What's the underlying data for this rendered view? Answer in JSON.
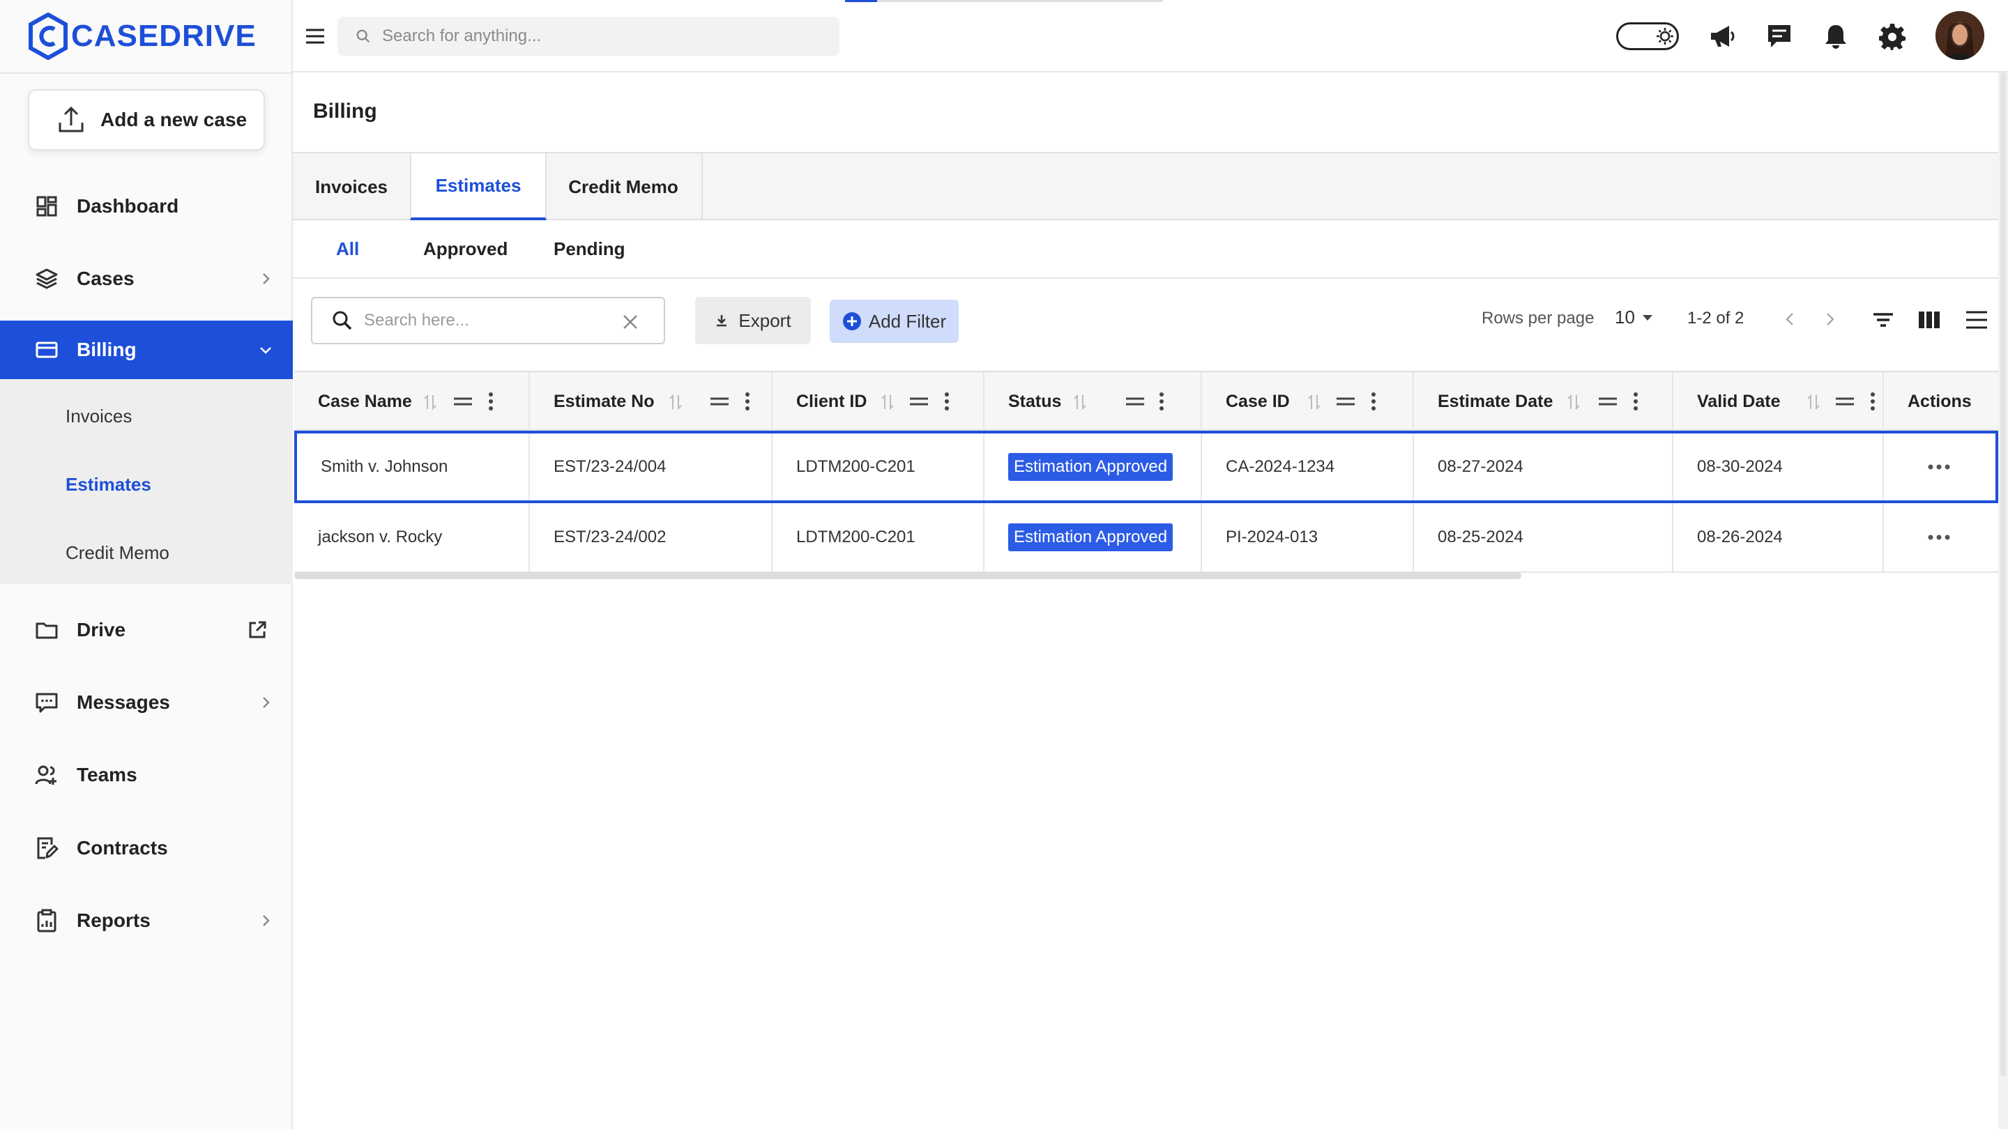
{
  "brand": {
    "name": "CASEDRIVE",
    "color": "#1d4fd8"
  },
  "sidebar": {
    "add_case_label": "Add a new case",
    "items": [
      {
        "label": "Dashboard",
        "icon": "dashboard-icon"
      },
      {
        "label": "Cases",
        "icon": "layers-icon"
      },
      {
        "label": "Billing",
        "icon": "credit-card-icon",
        "active": true
      },
      {
        "label": "Drive",
        "icon": "folder-icon"
      },
      {
        "label": "Messages",
        "icon": "message-icon"
      },
      {
        "label": "Teams",
        "icon": "team-icon"
      },
      {
        "label": "Contracts",
        "icon": "contract-icon"
      },
      {
        "label": "Reports",
        "icon": "clipboard-icon"
      }
    ],
    "billing_sub": [
      {
        "label": "Invoices"
      },
      {
        "label": "Estimates",
        "active": true
      },
      {
        "label": "Credit Memo"
      }
    ]
  },
  "topbar": {
    "search_placeholder": "Search for anything...",
    "loading_progress": 0.1
  },
  "page": {
    "title": "Billing",
    "tabs": [
      {
        "label": "Invoices"
      },
      {
        "label": "Estimates",
        "active": true
      },
      {
        "label": "Credit Memo"
      }
    ],
    "subtabs": [
      {
        "label": "All",
        "active": true
      },
      {
        "label": "Approved"
      },
      {
        "label": "Pending"
      }
    ]
  },
  "toolbar": {
    "search_placeholder": "Search here...",
    "export_label": "Export",
    "add_filter_label": "Add Filter",
    "rows_per_page_label": "Rows per page",
    "rows_per_page_value": "10",
    "page_range": "1-2 of 2"
  },
  "table": {
    "columns": [
      "Case Name",
      "Estimate No",
      "Client ID",
      "Status",
      "Case ID",
      "Estimate Date",
      "Valid Date",
      "Actions"
    ],
    "rows": [
      {
        "case_name": "Smith v. Johnson",
        "estimate_no": "EST/23-24/004",
        "client_id": "LDTM200-C201",
        "status": "Estimation Approved",
        "case_id": "CA-2024-1234",
        "estimate_date": "08-27-2024",
        "valid_date": "08-30-2024"
      },
      {
        "case_name": "jackson v. Rocky",
        "estimate_no": "EST/23-24/002",
        "client_id": "LDTM200-C201",
        "status": "Estimation Approved",
        "case_id": "PI-2024-013",
        "estimate_date": "08-25-2024",
        "valid_date": "08-26-2024"
      }
    ],
    "status_color": "#2c5ce6"
  }
}
